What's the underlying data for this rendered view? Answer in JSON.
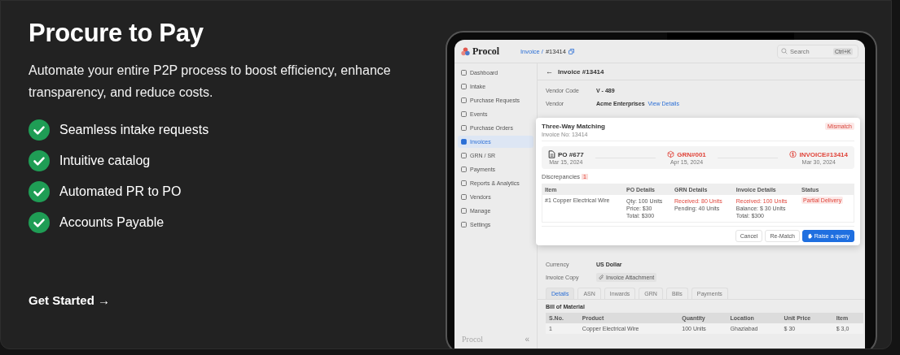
{
  "hero": {
    "title": "Procure to Pay",
    "subtitle": "Automate your entire P2P process to boost efficiency, enhance transparency, and reduce costs.",
    "features": [
      "Seamless intake requests",
      "Intuitive catalog",
      "Automated PR to PO",
      "Accounts Payable"
    ],
    "cta": "Get Started",
    "cta_arrow": "→"
  },
  "app": {
    "logo": "Procol",
    "breadcrumb": {
      "parent": "Invoice /",
      "current": "#13414"
    },
    "search": {
      "placeholder": "Search",
      "shortcut": "Ctrl+K"
    },
    "sidebar": {
      "items": [
        {
          "label": "Dashboard",
          "selected": false
        },
        {
          "label": "Intake",
          "selected": false
        },
        {
          "label": "Purchase Requests",
          "selected": false
        },
        {
          "label": "Events",
          "selected": false
        },
        {
          "label": "Purchase Orders",
          "selected": false
        },
        {
          "label": "Invoices",
          "selected": true
        },
        {
          "label": "GRN / SR",
          "selected": false
        },
        {
          "label": "Payments",
          "selected": false
        },
        {
          "label": "Reports & Analytics",
          "selected": false
        },
        {
          "label": "Vendors",
          "selected": false
        },
        {
          "label": "Manage",
          "selected": false
        },
        {
          "label": "Settings",
          "selected": false
        }
      ],
      "footer_logo": "Procol",
      "collapse": "«"
    },
    "back_arrow": "←",
    "page_title": "Invoice #13414",
    "fields_top": [
      {
        "label": "Vendor Code",
        "value": "V - 489",
        "kind": "text"
      },
      {
        "label": "Vendor",
        "value": "Acme Enterprises",
        "link": "View Details",
        "kind": "link"
      }
    ],
    "fields_bottom": [
      {
        "label": "Currency",
        "value": "US Dollar",
        "kind": "text"
      },
      {
        "label": "Invoice Copy",
        "value": "Invoice Attachment",
        "kind": "attachment"
      }
    ],
    "tabs": [
      {
        "label": "Details",
        "selected": true
      },
      {
        "label": "ASN",
        "selected": false
      },
      {
        "label": "Inwards",
        "selected": false
      },
      {
        "label": "GRN",
        "selected": false
      },
      {
        "label": "Bills",
        "selected": false
      },
      {
        "label": "Payments",
        "selected": false
      }
    ],
    "bom": {
      "title": "Bill of Material",
      "columns": [
        "S.No.",
        "Product",
        "Quantity",
        "Location",
        "Unit Price",
        "Item"
      ],
      "rows": [
        [
          "1",
          "Copper Electrical Wire",
          "100 Units",
          "Ghaziabad",
          "$ 30",
          "$ 3,0"
        ]
      ]
    },
    "modal": {
      "title": "Three-Way Matching",
      "subtitle": "Invoice No: 13414",
      "badge": "Mismatch",
      "stages": [
        {
          "kind": "document",
          "label": "PO #677",
          "date": "Mar 15, 2024",
          "mismatch": false
        },
        {
          "kind": "package",
          "label": "GRN#001",
          "date": "Apr 15, 2024",
          "mismatch": true
        },
        {
          "kind": "dollar",
          "label": "INVOICE#13414",
          "date": "Mar 30, 2024",
          "mismatch": true
        }
      ],
      "discrepancies_label": "Discrepancies",
      "discrepancies_count": "1",
      "columns": [
        "Item",
        "PO Details",
        "GRN Details",
        "Invoice Details",
        "Status"
      ],
      "row": {
        "item": "#1 Copper Electrical Wire",
        "po": [
          {
            "text": "Qty: 100 Units",
            "alert": false
          },
          {
            "text": "Price: $30",
            "alert": false
          },
          {
            "text": "Total: $300",
            "alert": false
          }
        ],
        "grn": [
          {
            "text": "Received: 80 Units",
            "alert": true
          },
          {
            "text": "Pending: 40 Units",
            "alert": false
          }
        ],
        "invoice": [
          {
            "text": "Received: 100 Units",
            "alert": true
          },
          {
            "text": "Balance: $ 30 Units",
            "alert": false
          },
          {
            "text": "Total: $300",
            "alert": false
          }
        ],
        "status": "Partial Delivery"
      },
      "buttons": [
        {
          "label": "Cancel",
          "kind": "secondary"
        },
        {
          "label": "Re-Match",
          "kind": "secondary"
        },
        {
          "label": "Raise a query",
          "kind": "primary"
        }
      ]
    }
  }
}
